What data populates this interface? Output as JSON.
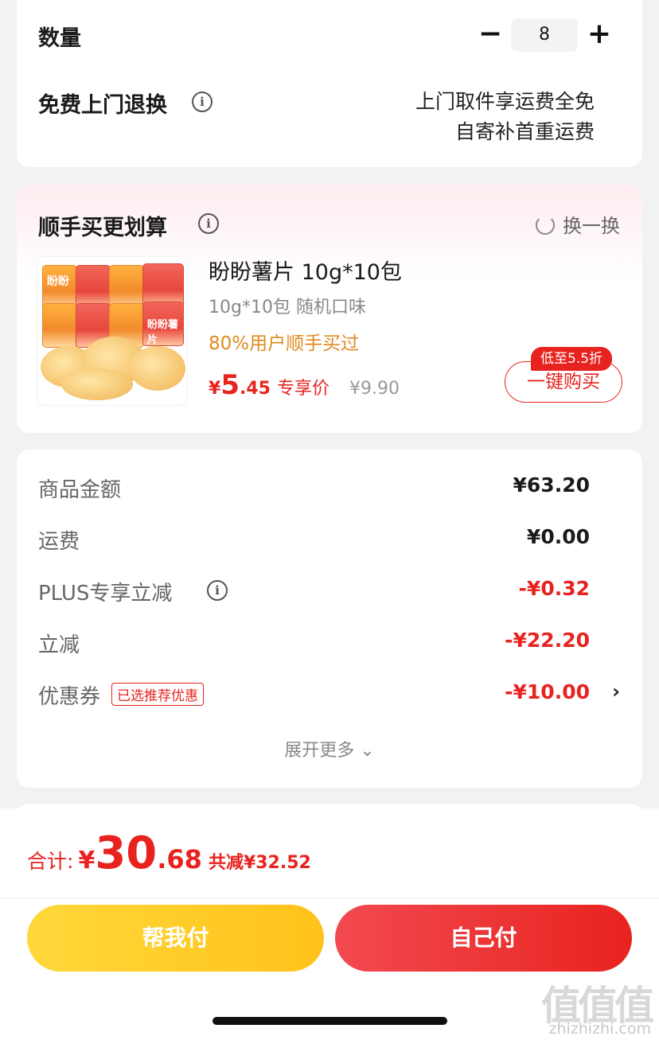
{
  "quantity_card": {
    "qty_label": "数量",
    "qty_minus": "−",
    "qty_value": "8",
    "qty_plus": "+",
    "return_label": "免费上门退换",
    "return_info": "i",
    "return_line1": "上门取件享运费全免",
    "return_line2": "自寄补首重运费"
  },
  "addon_card": {
    "title": "顺手买更划算",
    "title_info": "i",
    "swap_label": "换一换",
    "product": {
      "name": "盼盼薯片 10g*10包",
      "spec": "10g*10包 随机口味",
      "social": "80%用户顺手买过",
      "price_symbol": "¥",
      "price_int": "5",
      "price_dec": ".45",
      "price_tag": "专享价",
      "original_price": "¥9.90",
      "badge": "低至5.5折",
      "buy_label": "一键购买",
      "bag_brand": "盼盼",
      "bag_title": "盼盼薯片"
    }
  },
  "summary": {
    "rows": [
      {
        "label": "商品金额",
        "value": "¥63.20"
      },
      {
        "label": "运费",
        "value": "¥0.00"
      },
      {
        "label": "PLUS专享立减",
        "value": "-¥0.32"
      },
      {
        "label": "立减",
        "value": "-¥22.20"
      },
      {
        "label": "优惠券",
        "tag": "已选推荐优惠",
        "value": "-¥10.00",
        "chevron": "›"
      }
    ],
    "plus_info": "i",
    "expand": "展开更多 ⌄"
  },
  "bottom": {
    "total_label": "合计:",
    "total_symbol": "¥",
    "total_int": "30",
    "total_dec": ".68",
    "total_saved": "共减¥32.52",
    "help_pay": "帮我付",
    "self_pay": "自己付"
  },
  "watermark": {
    "logo": "值值值",
    "url": "zhizhizhi.com"
  },
  "colors": {
    "accent_red": "#e8231f",
    "accent_orange": "#e08a1e",
    "help_pay_yellow": "#ffc21a"
  }
}
